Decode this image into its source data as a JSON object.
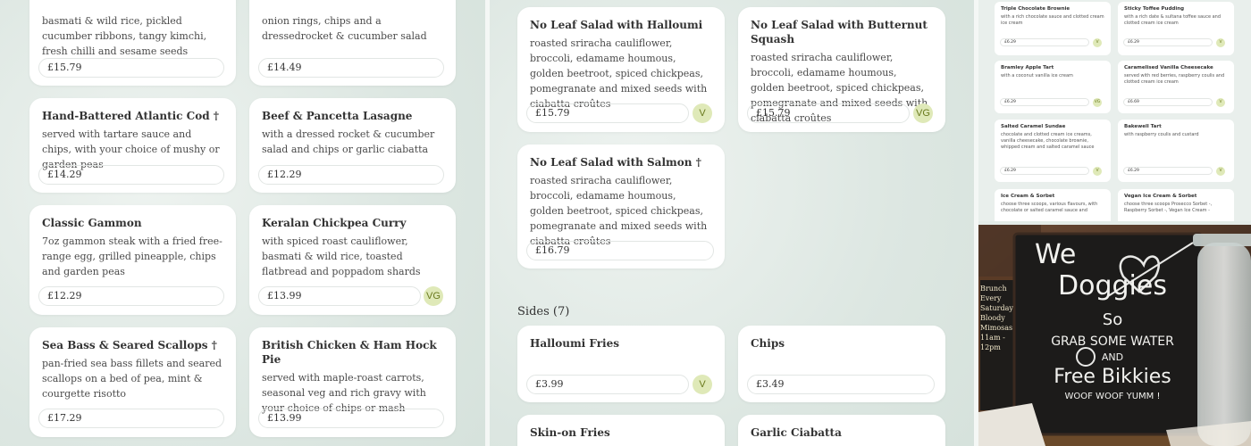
{
  "left_items": [
    {
      "title": "",
      "desc": "basmati & wild rice, pickled cucumber ribbons, tangy kimchi, fresh chilli and sesame seeds",
      "price": "£15.79"
    },
    {
      "title": "",
      "desc": "onion rings, chips and a dressedrocket & cucumber salad",
      "price": "£14.49"
    },
    {
      "title": "Hand-Battered Atlantic Cod †",
      "desc": "served with tartare sauce and chips, with your choice of mushy or garden peas",
      "price": "£14.29"
    },
    {
      "title": "Beef & Pancetta Lasagne",
      "desc": "with a dressed rocket & cucumber salad and chips or garlic ciabatta",
      "price": "£12.29"
    },
    {
      "title": "Classic Gammon",
      "desc": "7oz gammon steak with a fried free-range egg, grilled pineapple, chips and garden peas",
      "price": "£12.29"
    },
    {
      "title": "Keralan Chickpea Curry",
      "desc": "with spiced roast cauliflower, basmati & wild rice, toasted flatbread and poppadom shards",
      "price": "£13.99",
      "badge": "VG"
    },
    {
      "title": "Sea Bass & Seared Scallops †",
      "desc": "pan-fried sea bass fillets and seared scallops on a bed of pea, mint & courgette risotto",
      "price": "£17.29"
    },
    {
      "title": "British Chicken & Ham Hock Pie",
      "desc": "served with maple-roast carrots, seasonal veg and rich gravy with your choice of chips or mash",
      "price": "£13.99"
    }
  ],
  "middle_items": [
    {
      "title": "No Leaf Salad with Halloumi",
      "desc": "roasted sriracha cauliflower, broccoli, edamame houmous, golden beetroot, spiced chickpeas, pomegranate and mixed seeds with ciabatta croûtes",
      "price": "£15.79",
      "badge": "V"
    },
    {
      "title": "No Leaf Salad with Butternut Squash",
      "desc": "roasted sriracha cauliflower, broccoli, edamame houmous, golden beetroot, spiced chickpeas, pomegranate and mixed seeds with ciabatta croûtes",
      "price": "£15.79",
      "badge": "VG"
    },
    {
      "title": "No Leaf Salad with Salmon †",
      "desc": "roasted sriracha cauliflower, broccoli, edamame houmous, golden beetroot, spiced chickpeas, pomegranate and mixed seeds with ciabatta croûtes",
      "price": "£16.79"
    }
  ],
  "sides_heading": "Sides (7)",
  "sides": [
    {
      "title": "Halloumi Fries",
      "price": "£3.99",
      "badge": "V"
    },
    {
      "title": "Chips",
      "price": "£3.49"
    },
    {
      "title": "Skin-on Fries"
    },
    {
      "title": "Garlic Ciabatta"
    }
  ],
  "desserts": [
    {
      "title": "Triple Chocolate Brownie",
      "desc": "with a rich chocolate sauce and clotted cream ice cream",
      "price": "£6.29",
      "badge": "V"
    },
    {
      "title": "Sticky Toffee Pudding",
      "desc": "with a rich date & sultana toffee sauce and clotted cream ice cream",
      "price": "£6.29",
      "badge": "V"
    },
    {
      "title": "Bramley Apple Tart",
      "desc": "with a coconut vanilla ice cream",
      "price": "£6.29",
      "badge": "VG"
    },
    {
      "title": "Caramelised Vanilla Cheesecake",
      "desc": "served with red berries, raspberry coulis and clotted cream ice cream",
      "price": "£6.69",
      "badge": "V"
    },
    {
      "title": "Salted Caramel Sundae",
      "desc": "chocolate and clotted cream ice creams, vanilla cheesecake, chocolate brownie, whipped cream and salted caramel sauce",
      "price": "£6.29",
      "badge": "V"
    },
    {
      "title": "Bakewell Tart",
      "desc": "with raspberry coulis and custard",
      "price": "£6.29",
      "badge": "V"
    },
    {
      "title": "Ice Cream & Sorbet",
      "desc": "choose three scoops, various flavours, with chocolate or salted caramel sauce and"
    },
    {
      "title": "Vegan Ice Cream & Sorbet",
      "desc": "choose three scoops Prosecco Sorbet -, Raspberry Sorbet -, Vegan Ice Cream -"
    }
  ],
  "photo": {
    "sign_lines": [
      "We",
      "Doggies",
      "So",
      "GRAB SOME WATER",
      "AND",
      "Free Bikkies",
      "WOOF WOOF YUMM !"
    ],
    "board_text": [
      "Brunch",
      "Every Saturday",
      "Bloody",
      "Mimosas",
      "11am - 12pm"
    ]
  }
}
